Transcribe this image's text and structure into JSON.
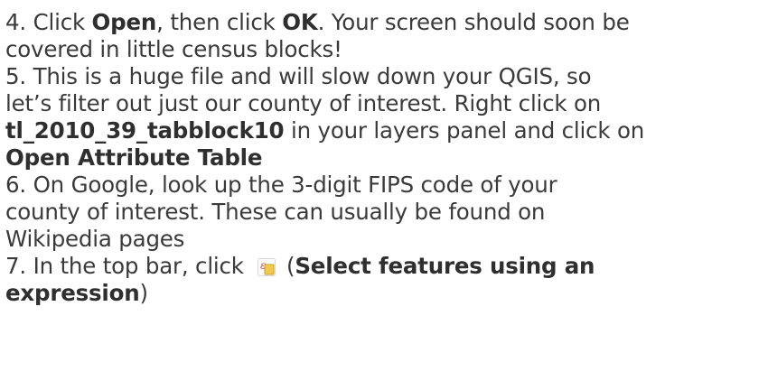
{
  "steps": [
    {
      "number": "4.",
      "parts": {
        "a": " Click ",
        "b": "Open",
        "c": ", then click ",
        "d": "OK",
        "e": ". Your screen should soon be",
        "f": "covered in little census blocks!"
      }
    },
    {
      "number": "5.",
      "parts": {
        "a": " This is a huge file and will slow down your QGIS, so",
        "b": "let’s filter out just our county of interest. Right click on",
        "c": "tl_2010_39_tabblock10",
        "d": " in your layers panel and click on",
        "e": "Open Attribute Table"
      }
    },
    {
      "number": "6.",
      "parts": {
        "a": " On Google, look up the 3-digit FIPS code of your",
        "b": "county of interest. These can usually be found on",
        "c": "Wikipedia pages"
      }
    },
    {
      "number": "7.",
      "parts": {
        "a": " In the top bar, click ",
        "icon": "select-by-expression-icon",
        "b": " (",
        "c": "Select features using an",
        "d": "expression",
        "e": ")"
      }
    }
  ],
  "colors": {
    "text": "#3a3a3a",
    "icon_yellow": "#f2c94c",
    "icon_red": "#d9534f"
  }
}
